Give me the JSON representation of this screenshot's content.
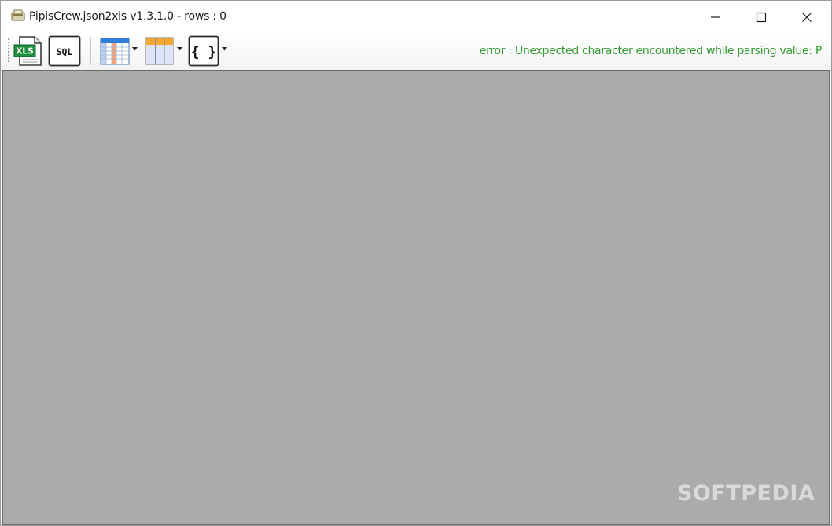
{
  "window": {
    "title": "PipisCrew.json2xls v1.3.1.0 - rows : 0"
  },
  "toolbar": {
    "buttons": [
      {
        "name": "export-xls",
        "label": "XLS"
      },
      {
        "name": "export-sql",
        "label": "SQL"
      },
      {
        "name": "table-view"
      },
      {
        "name": "columns-view"
      },
      {
        "name": "json-format",
        "label": "{ }"
      }
    ],
    "status_message": "error : Unexpected character encountered while parsing value: P"
  },
  "watermark": "SOFTPEDIA",
  "colors": {
    "error_text": "#2e9b2e",
    "workspace": "#ababab",
    "excel_green": "#1e8f3e"
  }
}
